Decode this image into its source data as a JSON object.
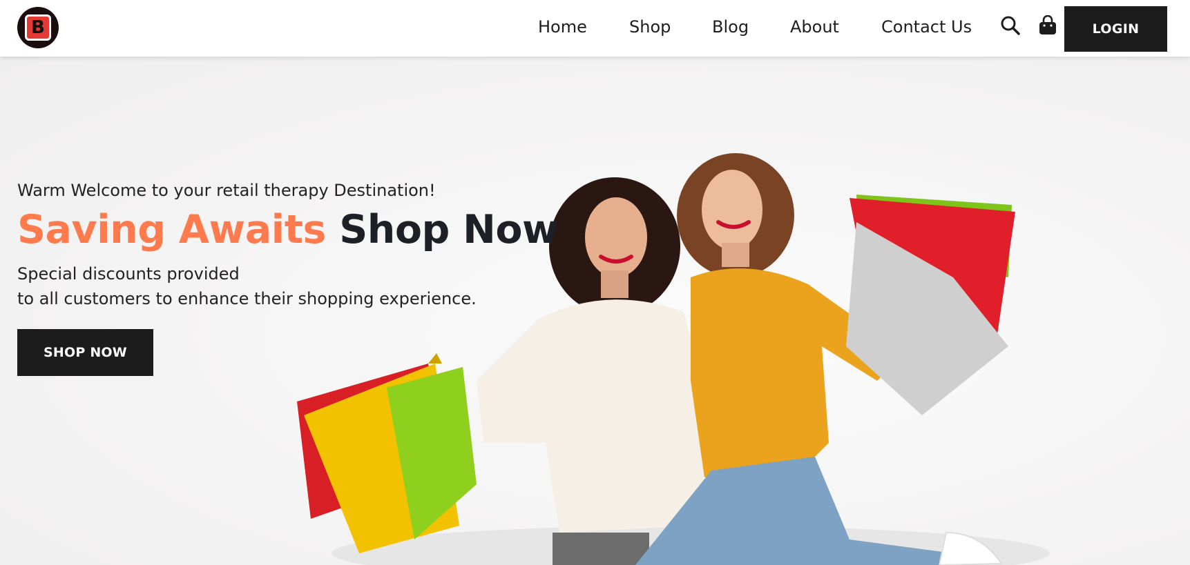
{
  "brand": {
    "logo_letter": "B",
    "logo_icon": "brand-logo-icon"
  },
  "nav": {
    "items": [
      {
        "label": "Home"
      },
      {
        "label": "Shop"
      },
      {
        "label": "Blog"
      },
      {
        "label": "About"
      },
      {
        "label": "Contact Us"
      }
    ],
    "search_icon": "search-icon",
    "cart_icon": "shopping-bag-icon",
    "login_label": "LOGIN"
  },
  "hero": {
    "welcome": "Warm Welcome to your retail therapy Destination!",
    "headline_accent": "Saving Awaits",
    "headline_dark": "Shop Now",
    "sub_line1": "Special discounts provided",
    "sub_line2": "to all customers to enhance their shopping experience.",
    "cta_label": "SHOP NOW",
    "image_desc": "Two women jumping with colorful shopping bags"
  },
  "colors": {
    "accent": "#ff7a4d",
    "dark": "#1c1c1c",
    "header_bg": "#ffffff"
  }
}
